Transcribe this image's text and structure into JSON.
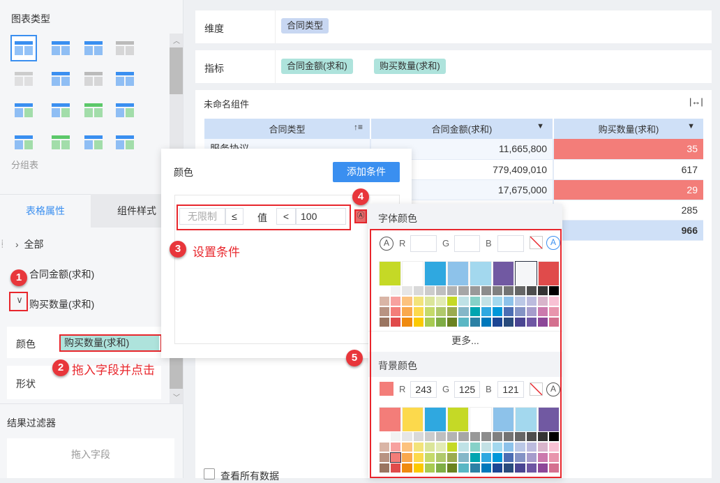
{
  "left": {
    "chart_type_title": "图表类型",
    "group_table_label": "分组表",
    "tabs": [
      "表格属性",
      "组件样式"
    ],
    "tree": [
      {
        "label": "全部"
      },
      {
        "label": "合同金额(求和)"
      },
      {
        "label": "购买数量(求和)"
      }
    ],
    "color_label": "颜色",
    "color_field": "购买数量(求和)",
    "shape_label": "形状",
    "filter_title": "结果过滤器",
    "filter_placeholder": "拖入字段"
  },
  "main": {
    "dimension_label": "维度",
    "dimension_tags": [
      "合同类型"
    ],
    "metric_label": "指标",
    "metric_tags": [
      "合同金额(求和)",
      "购买数量(求和)"
    ],
    "component_title": "未命名组件",
    "columns": [
      "合同类型",
      "合同金额(求和)",
      "购买数量(求和)"
    ],
    "rows": [
      {
        "type": "服务协议",
        "amount": "11,665,800",
        "qty": "35",
        "highlight": true
      },
      {
        "type": "",
        "amount": "779,409,010",
        "qty": "617",
        "highlight": false
      },
      {
        "type": "",
        "amount": "17,675,000",
        "qty": "29",
        "highlight": true
      },
      {
        "type": "",
        "amount": "",
        "qty": "285",
        "highlight": false
      }
    ],
    "total_qty": "966",
    "view_all_label": "查看所有数据"
  },
  "popup": {
    "title": "颜色",
    "add_condition": "添加条件",
    "cond_min_placeholder": "无限制",
    "cond_op1": "≤",
    "cond_value_label": "值",
    "cond_op2": "<",
    "cond_value": "100"
  },
  "picker": {
    "font_title": "字体颜色",
    "bg_title": "背景颜色",
    "more": "更多...",
    "r_label": "R",
    "g_label": "G",
    "b_label": "B",
    "bg_r": "243",
    "bg_g": "125",
    "bg_b": "121",
    "bg_current": "#f37d79",
    "font_quick": [
      "#c5d926",
      "#ffffff",
      "#2fa8e0",
      "#8dc2ea",
      "#a3d8ee",
      "#7159a2",
      "#f5f6f8",
      "#e04b4b"
    ],
    "bg_quick": [
      "#f37d79",
      "#fcd94c",
      "#2fa8e0",
      "#c5d926",
      "#ffffff",
      "#8dc2ea",
      "#a3d8ee",
      "#7159a2"
    ],
    "palette": [
      [
        "#ffffff",
        "#f2f2f2",
        "#e6e6e6",
        "#d9d9d9",
        "#cccccc",
        "#bfbfbf",
        "#b3b3b3",
        "#a6a6a6",
        "#999999",
        "#8c8c8c",
        "#808080",
        "#737373",
        "#666666",
        "#4d4d4d",
        "#333333",
        "#000000"
      ],
      [
        "#d9b5a6",
        "#f7a19f",
        "#fcc27e",
        "#f3e37a",
        "#dbe59a",
        "#e2ebb4",
        "#c5d926",
        "#bfe2e6",
        "#86d1c8",
        "#c3e1e5",
        "#a3d8ee",
        "#8dc2ea",
        "#bbc8e6",
        "#bcbbde",
        "#d8b4cb",
        "#f8c1d4"
      ],
      [
        "#b89382",
        "#f37d79",
        "#f9a84d",
        "#fcd94c",
        "#c5da6a",
        "#b0c96b",
        "#9bab4f",
        "#84b7c8",
        "#00a5b0",
        "#2fa8e0",
        "#0097d9",
        "#4b6db3",
        "#8493c5",
        "#a69ccc",
        "#cb79ad",
        "#e895ad"
      ],
      [
        "#9a7561",
        "#e04b4b",
        "#ef8a0f",
        "#fbc900",
        "#a8cb52",
        "#7fad45",
        "#6a8220",
        "#5ab7c4",
        "#2c81a5",
        "#0078bb",
        "#1c4694",
        "#294b7c",
        "#4a4592",
        "#6e56a3",
        "#8d4798",
        "#d4708f"
      ]
    ]
  },
  "annotations": {
    "n1": "1",
    "n2": "2",
    "n3": "3",
    "n4": "4",
    "n5": "5",
    "t2": "拖入字段并点击",
    "t3": "设置条件"
  },
  "colors": {
    "accent": "#3a8ff0",
    "highlight": "#f37d79",
    "annotation": "#e8262c"
  }
}
